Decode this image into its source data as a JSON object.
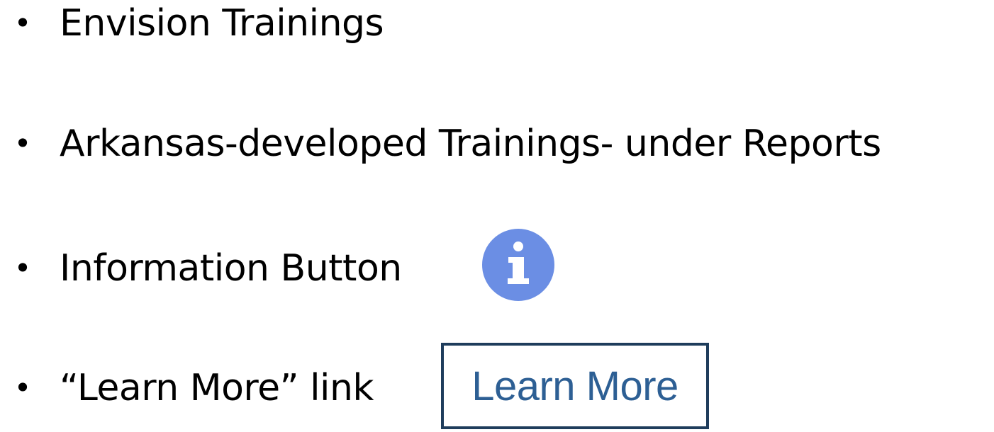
{
  "bullet_symbol": "•",
  "items": [
    {
      "text": "Envision Trainings"
    },
    {
      "text": "Arkansas-developed Trainings- under Reports"
    },
    {
      "text": "Information Button"
    },
    {
      "text": "“Learn More” link"
    }
  ],
  "info_button": {
    "icon": "info-circle-icon",
    "color": "#6b8ee4"
  },
  "learn_more_button": {
    "label": "Learn More",
    "text_color": "#2d5f94",
    "border_color": "#1f3d5c"
  }
}
